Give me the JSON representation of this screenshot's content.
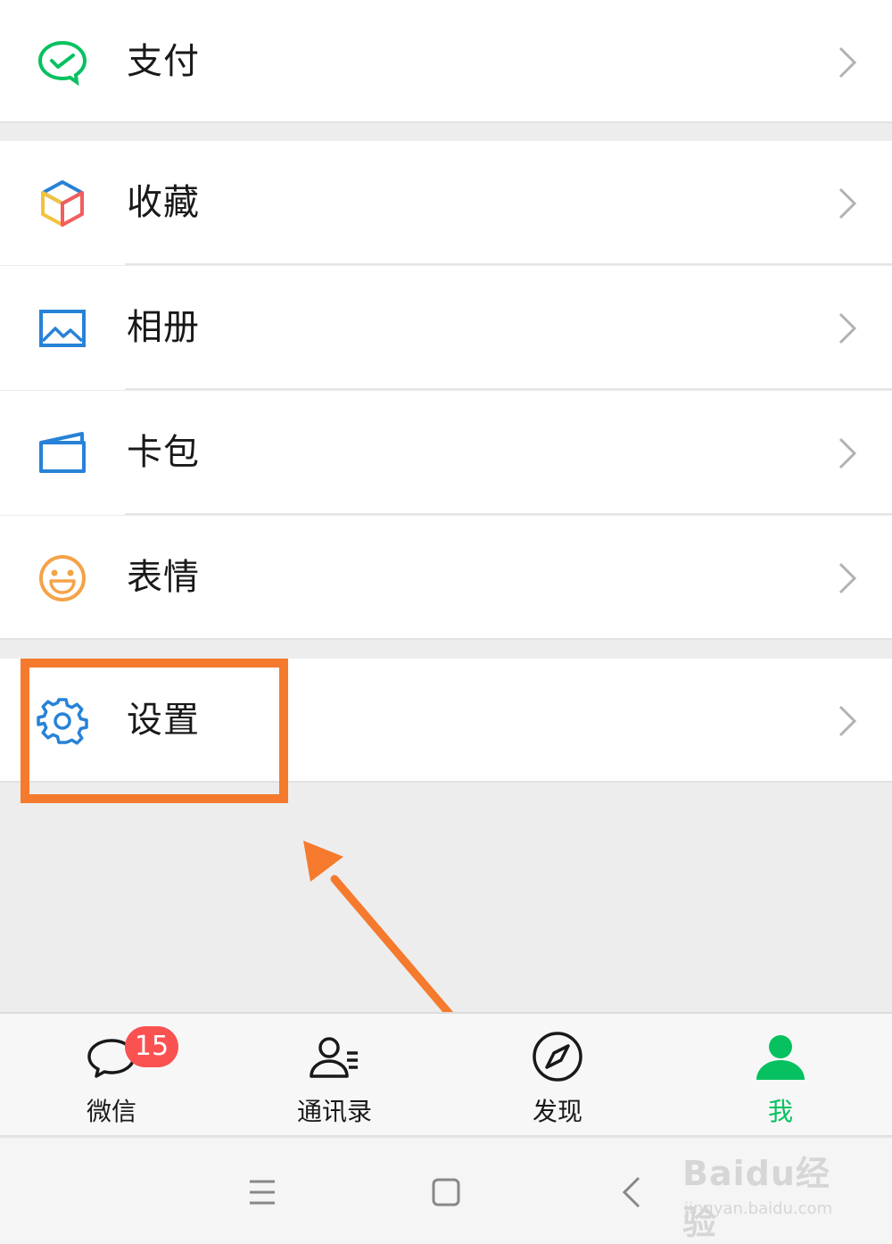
{
  "menu": {
    "pay": {
      "label": "支付",
      "icon": "wechat-pay-icon",
      "color": "#07c160"
    },
    "favorites": {
      "label": "收藏",
      "icon": "favorites-cube-icon"
    },
    "album": {
      "label": "相册",
      "icon": "album-icon",
      "color": "#2782d7"
    },
    "cards": {
      "label": "卡包",
      "icon": "card-wallet-icon",
      "color": "#2782d7"
    },
    "stickers": {
      "label": "表情",
      "icon": "smiley-icon",
      "color": "#f4a348"
    },
    "settings": {
      "label": "设置",
      "icon": "gear-icon",
      "color": "#2782d7"
    }
  },
  "annotation": {
    "highlight_color": "#f57a2d",
    "target": "settings"
  },
  "tabbar": {
    "tabs": [
      {
        "label": "微信",
        "icon": "chat-bubble-icon",
        "badge": "15"
      },
      {
        "label": "通讯录",
        "icon": "contacts-icon"
      },
      {
        "label": "发现",
        "icon": "compass-icon"
      },
      {
        "label": "我",
        "icon": "me-person-icon",
        "active": true
      }
    ],
    "active_color": "#07c160",
    "badge_color": "#fa5151"
  },
  "system_nav": {
    "buttons": [
      "menu-icon",
      "home-icon",
      "back-icon"
    ]
  },
  "watermark": {
    "brand": "Baidu经验",
    "url": "jingyan.baidu.com"
  }
}
